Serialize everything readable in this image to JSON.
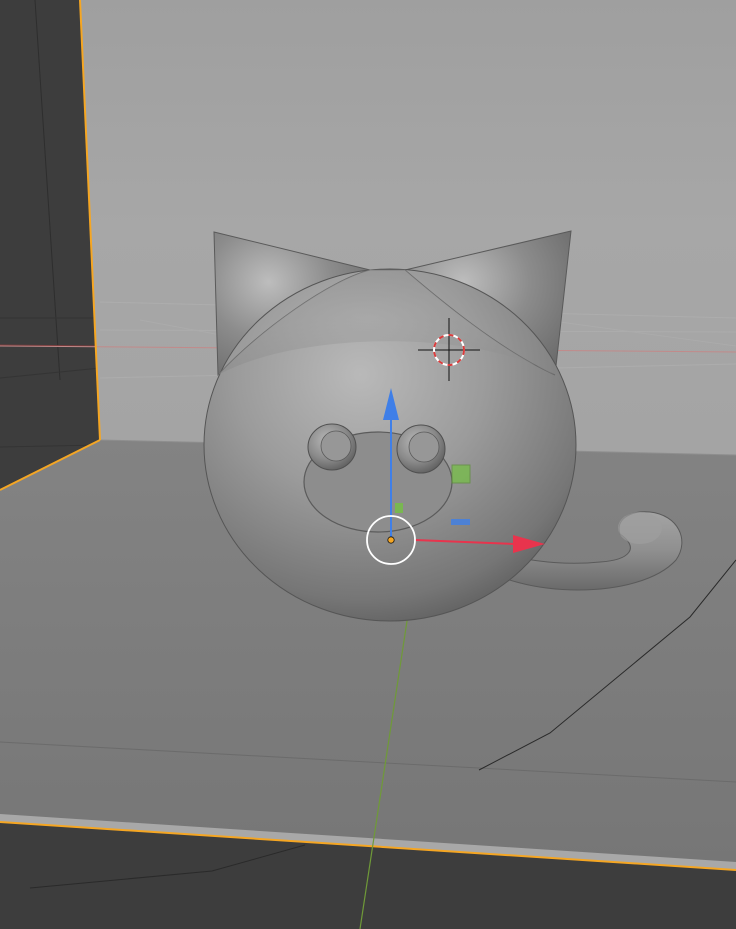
{
  "viewport": {
    "mode": "3d-viewport",
    "shading": "solid",
    "selection_outline_color": "#f5a623",
    "background_color": "#3d3d3d",
    "wall_color": "#a3a3a3",
    "floor_color": "#7c7c7c"
  },
  "scene": {
    "objects": [
      {
        "name": "cat-body",
        "kind": "sphere",
        "selected": false
      },
      {
        "name": "cat-ear-left",
        "kind": "cone",
        "selected": false
      },
      {
        "name": "cat-ear-right",
        "kind": "cone",
        "selected": false
      },
      {
        "name": "cat-eye-left",
        "kind": "sphere",
        "selected": false
      },
      {
        "name": "cat-eye-right",
        "kind": "sphere",
        "selected": false
      },
      {
        "name": "cat-tail",
        "kind": "curve",
        "selected": false
      },
      {
        "name": "backdrop-plane",
        "kind": "plane",
        "selected": true
      }
    ]
  },
  "gizmo": {
    "type": "translate",
    "x_axis_color": "#e8344d",
    "y_axis_color": "#74c242",
    "z_axis_color": "#3f7fe8",
    "pivot_color": "#f5a623"
  },
  "cursor_3d": {
    "icon": "crosshair-cursor-icon",
    "ring_color_a": "#d93c3c",
    "ring_color_b": "#ffffff"
  }
}
